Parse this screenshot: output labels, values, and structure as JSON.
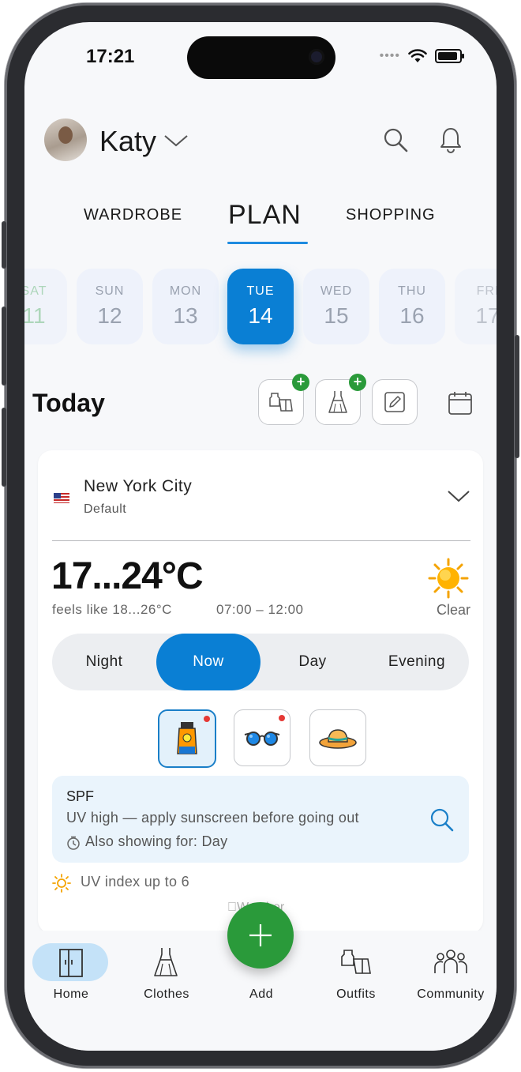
{
  "status_bar": {
    "time": "17:21"
  },
  "header": {
    "user_name": "Katy"
  },
  "tabs": [
    {
      "label": "WARDROBE"
    },
    {
      "label": "PLAN"
    },
    {
      "label": "SHOPPING"
    }
  ],
  "days": [
    {
      "name": "SAT",
      "num": "11"
    },
    {
      "name": "SUN",
      "num": "12"
    },
    {
      "name": "MON",
      "num": "13"
    },
    {
      "name": "TUE",
      "num": "14",
      "selected": true
    },
    {
      "name": "WED",
      "num": "15"
    },
    {
      "name": "THU",
      "num": "16"
    },
    {
      "name": "FRI",
      "num": "17"
    }
  ],
  "today": {
    "title": "Today"
  },
  "weather": {
    "city": "New York City",
    "city_sub": "Default",
    "temp": "17...24°C",
    "feels": "feels like 18...26°C",
    "time_range": "07:00 – 12:00",
    "condition": "Clear",
    "segments": [
      "Night",
      "Now",
      "Day",
      "Evening"
    ],
    "active_segment": "Now",
    "items": [
      {
        "icon": "sunscreen-icon",
        "selected": true
      },
      {
        "icon": "sunglasses-icon",
        "selected": false
      },
      {
        "icon": "sun-hat-icon",
        "selected": false
      }
    ],
    "tip": {
      "title": "SPF",
      "text": "UV high — apply sunscreen before going out",
      "also": "Also showing for: Day"
    },
    "uv": "UV index up to 6",
    "source": "Weather"
  },
  "nav": [
    {
      "label": "Home"
    },
    {
      "label": "Clothes"
    },
    {
      "label": "Add"
    },
    {
      "label": "Outfits"
    },
    {
      "label": "Community"
    }
  ],
  "colors": {
    "accent": "#0a7fd4",
    "green": "#2a9a3a",
    "tip_bg": "#eaf4fc"
  }
}
